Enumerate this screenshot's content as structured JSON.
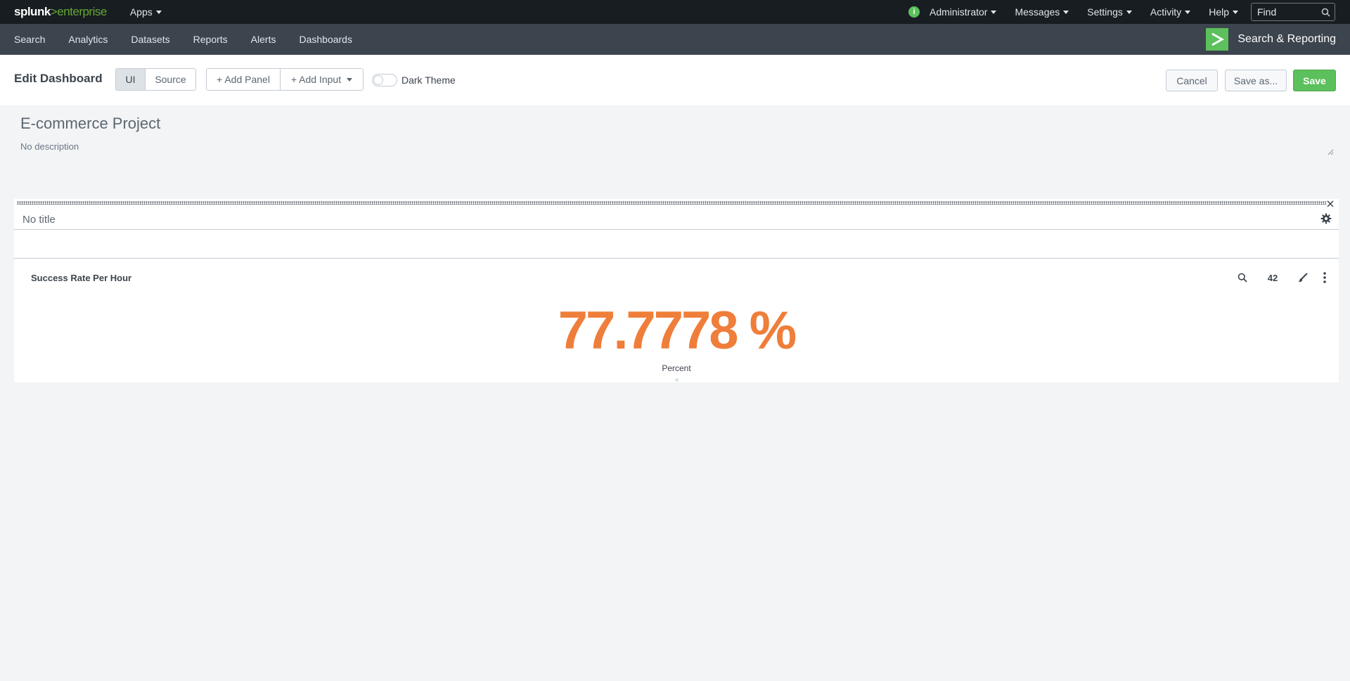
{
  "topbar": {
    "logo_main": "splunk",
    "logo_gt": ">",
    "logo_product": "enterprise",
    "apps_label": "Apps",
    "menus": [
      "Administrator",
      "Messages",
      "Settings",
      "Activity",
      "Help"
    ],
    "find_placeholder": "Find"
  },
  "appbar": {
    "nav": [
      "Search",
      "Analytics",
      "Datasets",
      "Reports",
      "Alerts",
      "Dashboards"
    ],
    "app_name": "Search & Reporting"
  },
  "editbar": {
    "title": "Edit Dashboard",
    "mode_ui": "UI",
    "mode_source": "Source",
    "add_panel": "+ Add Panel",
    "add_input": "+ Add Input",
    "dark_theme_label": "Dark Theme",
    "cancel": "Cancel",
    "save_as": "Save as...",
    "save": "Save"
  },
  "dashboard": {
    "title": "E-commerce Project",
    "description": "No description"
  },
  "row": {
    "title": "No title"
  },
  "panel": {
    "title": "Success Rate Per Hour",
    "result_count": "42",
    "value": "77.7778 %",
    "unit_label": "Percent",
    "value_color": "#ef7e3a"
  },
  "colors": {
    "accent_green": "#5cc05c",
    "topbar": "#171d21",
    "appbar": "#3c444d"
  }
}
